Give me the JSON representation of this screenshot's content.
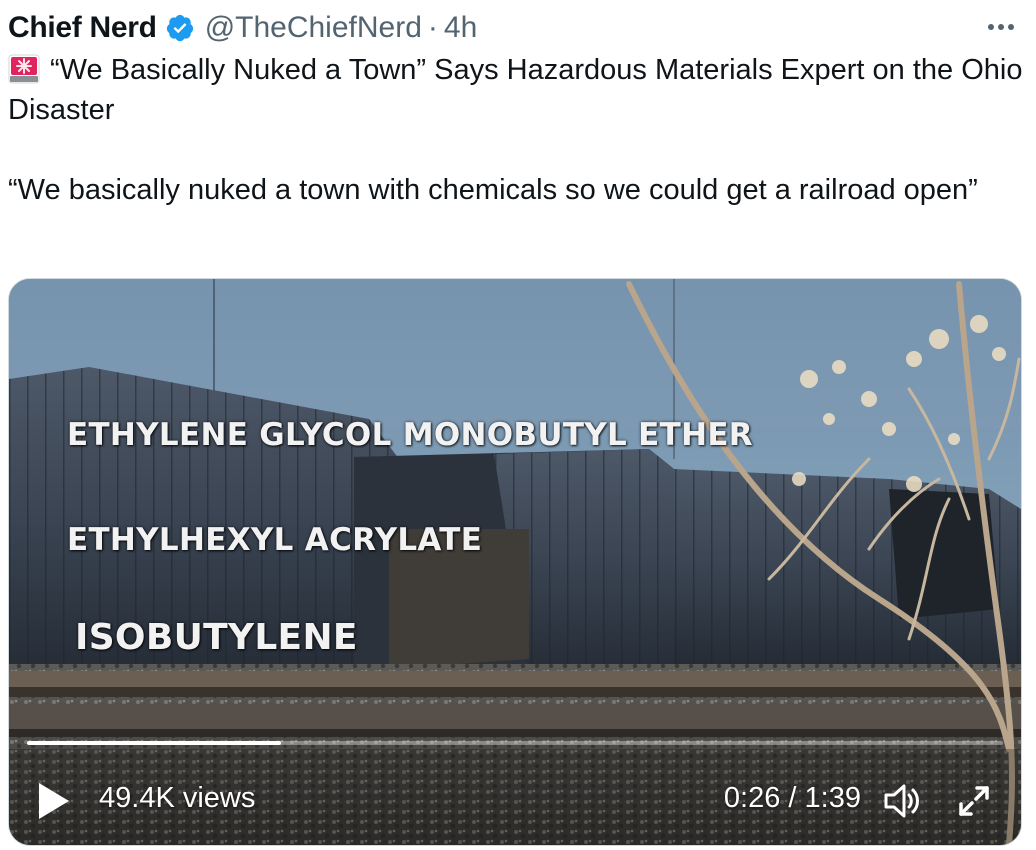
{
  "tweet": {
    "author": {
      "display_name": "Chief Nerd",
      "handle": "@TheChiefNerd",
      "separator": "·",
      "time": "4h",
      "verified": true
    },
    "text": {
      "emoji": "rotating-light",
      "line1": "“We Basically Nuked a Town” Says Hazardous Materials Expert on the Ohio Disaster",
      "line2": "“We basically nuked a town with chemicals so we could get a railroad open”"
    },
    "video": {
      "overlay_lines": [
        "ETHYLENE GLYCOL MONOBUTYL ETHER",
        "ETHYLHEXYL ACRYLATE",
        "ISOBUTYLENE"
      ],
      "views": "49.4K views",
      "current_time": "0:26",
      "time_separator": " / ",
      "duration": "1:39",
      "progress_fraction": 0.26
    }
  },
  "icons": {
    "verified": "verified-badge-icon",
    "more": "more-options-icon",
    "play": "play-icon",
    "volume": "volume-icon",
    "fullscreen": "fullscreen-icon"
  },
  "colors": {
    "verified_blue": "#1d9bf0",
    "text_primary": "#0f1419",
    "text_secondary": "#536471"
  }
}
